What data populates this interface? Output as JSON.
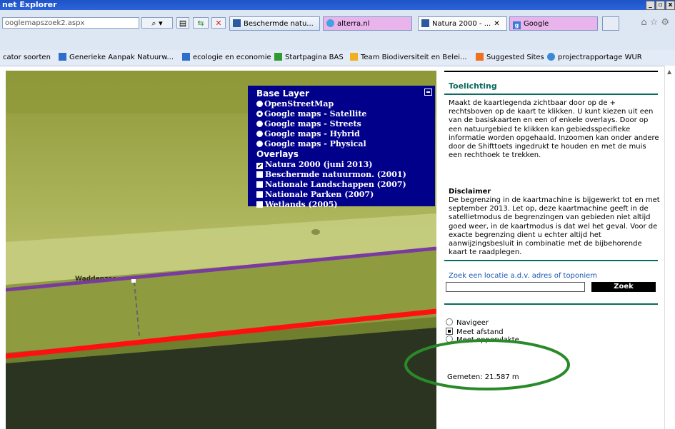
{
  "window": {
    "title": "net Explorer"
  },
  "address": {
    "url": "ooglemapszoek2.aspx"
  },
  "tabs": [
    {
      "label": "Beschermde natu...",
      "active": false
    },
    {
      "label": "alterra.nl",
      "active": false
    },
    {
      "label": "Natura 2000 - ...",
      "active": true,
      "close": "✕"
    },
    {
      "label": "Google",
      "active": false
    }
  ],
  "favorites": [
    {
      "label": "cator soorten"
    },
    {
      "label": "Generieke Aanpak Natuurw..."
    },
    {
      "label": "ecologie en economie"
    },
    {
      "label": "Startpagina BAS"
    },
    {
      "label": "Team Biodiversiteit en Belei..."
    },
    {
      "label": "Suggested Sites"
    },
    {
      "label": "projectrapportage WUR"
    }
  ],
  "map": {
    "place_label": "Waddenzee",
    "layers": {
      "base_title": "Base Layer",
      "base_options": [
        {
          "label": "OpenStreetMap",
          "selected": false
        },
        {
          "label": "Google maps - Satellite",
          "selected": true
        },
        {
          "label": "Google maps - Streets",
          "selected": false
        },
        {
          "label": "Google maps - Hybrid",
          "selected": false
        },
        {
          "label": "Google maps - Physical",
          "selected": false
        }
      ],
      "overlay_title": "Overlays",
      "overlay_options": [
        {
          "label": "Natura 2000 (juni 2013)",
          "checked": true
        },
        {
          "label": "Beschermde natuurmon. (2001)",
          "checked": false
        },
        {
          "label": "Nationale Landschappen (2007)",
          "checked": false
        },
        {
          "label": "Nationale Parken (2007)",
          "checked": false
        },
        {
          "label": "Wetlands (2005)",
          "checked": false
        }
      ]
    },
    "line_colors": {
      "purple": "#7a3aa0",
      "red": "#ff1010"
    }
  },
  "panel": {
    "toelichting_title": "Toelichting",
    "toelichting_text": "Maakt de kaartlegenda zichtbaar door op de + rechtsboven op de kaart te klikken. U kunt kiezen uit een van de basiskaarten en een of enkele overlays. Door op een natuurgebied te klikken kan gebiedsspecifieke informatie worden opgehaald. Inzoomen kan onder andere door de Shifttoets ingedrukt te houden en met de muis een rechthoek te trekken.",
    "disclaimer_title": "Disclaimer",
    "disclaimer_text": "De begrenzing in de kaartmachine is bijgewerkt tot en met september 2013. Let op, deze kaartmachine geeft in de satellietmodus de begrenzingen van gebieden niet altijd goed weer, in de kaartmodus is dat wel het geval. Voor de exacte begrenzing dient u echter altijd het aanwijzingsbesluit in combinatie met de bijbehorende kaart te raadplegen.",
    "search_label": "Zoek een locatie a.d.v. adres of toponiem",
    "search_button": "Zoek",
    "options": [
      {
        "label": "Navigeer"
      },
      {
        "label": "Meet afstand"
      },
      {
        "label": "Meet oppervlakte"
      }
    ],
    "measure_result": "Gemeten: 21.587 m"
  },
  "colors": {
    "accent": "#0a6b5e",
    "layer_panel": "#00008b",
    "highlight_ellipse": "#2a8a2a"
  }
}
